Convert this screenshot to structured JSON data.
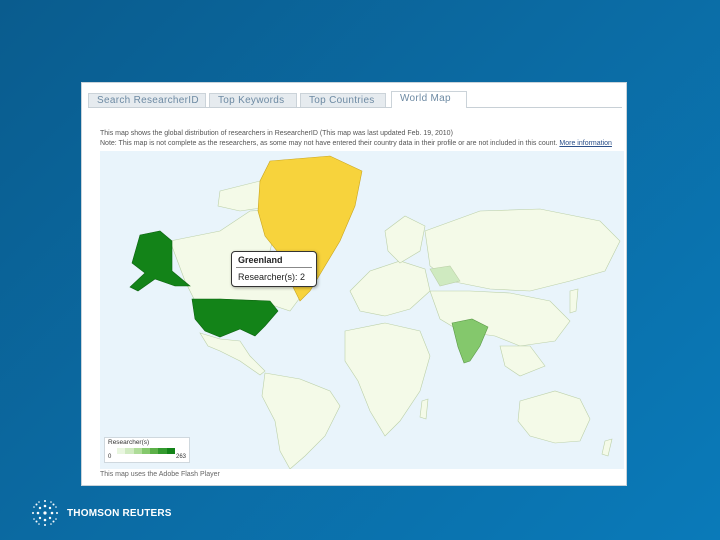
{
  "tabs": [
    {
      "label": "Search ResearcherID",
      "active": false
    },
    {
      "label": "Top Keywords",
      "active": false
    },
    {
      "label": "Top Countries",
      "active": false
    },
    {
      "label": "World Map",
      "active": true
    }
  ],
  "notes": {
    "line1": "This map shows the global distribution of researchers in ResearcherID (This map was last updated Feb. 19, 2010)",
    "line2": "Note: This map is not complete as the researchers, as some may not have entered their country data in their profile or are not included in this count.",
    "more_link": "More information"
  },
  "tooltip": {
    "country": "Greenland",
    "researchers": "Researcher(s): 2"
  },
  "legend": {
    "title": "Researcher(s)",
    "min": "0",
    "max": "263",
    "colors": [
      "#e9f6e0",
      "#cfeac0",
      "#aedc98",
      "#84c86c",
      "#5cb048",
      "#339a2e",
      "#138318"
    ]
  },
  "credit": "This map uses the Adobe Flash Player",
  "brand": {
    "name": "THOMSON REUTERS"
  },
  "map_colors": {
    "ocean": "#e9f4fb",
    "land_default": "#f4fae8",
    "greenland": "#f7d33c",
    "usa": "#138318",
    "alaska": "#138318",
    "india": "#84c86c",
    "russia_region": "#cfeac0"
  }
}
